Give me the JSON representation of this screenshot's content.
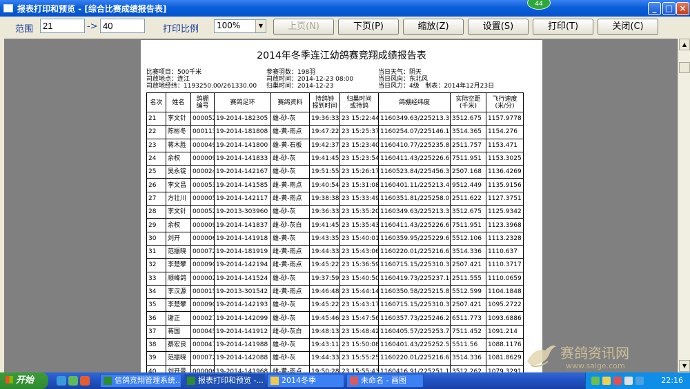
{
  "window": {
    "title": "报表打印和预览 - [综合比赛成绩报告表]",
    "badge": "44"
  },
  "toolbar": {
    "range_label": "范围",
    "range_from": "21",
    "range_arrow": "->",
    "range_to": "40",
    "print_scale_label": "打印比例",
    "print_scale_value": "100%",
    "prev_page": "上页(N)",
    "next_page": "下页(P)",
    "zoom": "缩放(Z)",
    "setup": "设置(S)",
    "print": "打印(T)",
    "close": "关闭(C)"
  },
  "report": {
    "title": "2014年冬季连江幼鸽赛竞翔成绩报告表",
    "info": {
      "project": "比赛项目：500千米",
      "release_place": "司放地点：连江",
      "release_coord": "司放地经纬：1193250.00/261330.00",
      "entries": "参赛羽数：198羽",
      "release_time": "司放时间：2014-12-23 08:00",
      "return_time": "归巢时间：2014-12-23",
      "weather": "当日天气：阴天",
      "wind_dir": "当日风向：东北风",
      "wind_force": "当日风力：4级",
      "made_on": "制表：2014年12月23日"
    },
    "columns": [
      "名次",
      "姓名",
      "鸽棚\n编号",
      "赛鸽足环",
      "赛鸽资料",
      "持鸽钟\n报到时间",
      "归巢时间\n或持鸽",
      "鸽棚经纬度",
      "实际空距\n(千米)",
      "飞行速度\n(米/分)"
    ],
    "rows": [
      [
        "21",
        "李文针",
        "000052",
        "19-2014-182305",
        "雄-砂-灰",
        "19:36:33",
        "23 15:22:44",
        "1160349.63/225213.3",
        "3512.675",
        "1157.9778"
      ],
      [
        "22",
        "陈彬冬",
        "000113",
        "19-2014-181808",
        "雄-黄-雨点",
        "19:47:22",
        "23 15:25:37",
        "1160254.07/225146.1",
        "3514.365",
        "1154.276"
      ],
      [
        "23",
        "蒋木胜",
        "000049",
        "19-2014-141800",
        "雄-黄-石板",
        "19:42:37",
        "23 15:23:40",
        "1160410.77/225235.8",
        "2511.757",
        "1153.471"
      ],
      [
        "24",
        "余权",
        "000009",
        "19-2014-141833",
        "雌-砂-灰",
        "19:41:45",
        "23 15:23:54",
        "1160411.43/225226.6",
        "7511.951",
        "1153.3025"
      ],
      [
        "25",
        "吴永锭",
        "000024",
        "19-2014-142167",
        "雄-砂-灰",
        "19:51:55",
        "23 15:26:17",
        "1160523.84/225456.3",
        "2507.168",
        "1136.4269"
      ],
      [
        "26",
        "李文昌",
        "000053",
        "19-2014-141585",
        "雌-黄-雨点",
        "19:40:54",
        "23 15:31:08",
        "1160401.11/225213.4",
        "9512.449",
        "1135.9156"
      ],
      [
        "27",
        "方壮川",
        "000005",
        "19-2014-142117",
        "雌-黄-雨点",
        "19:38:38",
        "23 15:33:49",
        "1160351.81/225258.0",
        "2511.622",
        "1127.3751"
      ],
      [
        "28",
        "李文针",
        "000052",
        "19-2013-303960",
        "雄-砂-灰",
        "19:36:33",
        "23 15:35:20",
        "1160349.63/225213.3",
        "3512.675",
        "1125.9342"
      ],
      [
        "29",
        "余权",
        "000009",
        "19-2014-141837",
        "雌-砂-灰白",
        "19:41:45",
        "23 15:35:43",
        "1160411.43/225226.6",
        "7511.951",
        "1123.3968"
      ],
      [
        "30",
        "刘开",
        "000006",
        "19-2014-141918",
        "雄-黄-灰",
        "19:43:35",
        "23 15:40:01",
        "1160359.95/225229.6",
        "5512.106",
        "1113.2328"
      ],
      [
        "31",
        "范振晓",
        "000072",
        "19-2014-181919",
        "雌-黄-雨点",
        "19:44:33",
        "23 15:43:06",
        "1160220.01/225216.6",
        "3514.336",
        "1110.637"
      ],
      [
        "32",
        "李楚攀",
        "000090",
        "19-2014-142194",
        "雌-黄-雨点",
        "19:45:22",
        "23 15:36:59",
        "1160715.15/225310.3",
        "2507.421",
        "1110.3717"
      ],
      [
        "33",
        "顺峰鸽",
        "000002",
        "19-2014-141524",
        "雄-砂-灰",
        "19:37:59",
        "23 15:40:50",
        "1160419.73/225237.1",
        "2511.555",
        "1110.0659"
      ],
      [
        "34",
        "李汉源",
        "000015",
        "19-2013-301542",
        "雌-黄-雨点",
        "19:46:48",
        "23 15:44:14",
        "1160350.58/225215.8",
        "5512.599",
        "1104.1848"
      ],
      [
        "35",
        "李楚攀",
        "000090",
        "19-2014-142193",
        "雄-砂-灰",
        "19:45:22",
        "23 15:43:17",
        "1160715.15/225310.3",
        "2507.421",
        "1095.2722"
      ],
      [
        "36",
        "谢正",
        "000027",
        "19-2014-142099",
        "雄-砂-灰",
        "19:45:46",
        "23 15:47:56",
        "1160357.73/225246.2",
        "6511.773",
        "1093.6886"
      ],
      [
        "37",
        "蒋国",
        "000045",
        "19-2014-141912",
        "雌-砂-灰白",
        "19:48:13",
        "23 15:48:42",
        "1160405.57/225253.7",
        "7511.452",
        "1091.214"
      ],
      [
        "38",
        "蔡宏良",
        "000047",
        "19-2014-141988",
        "雄-砂-灰",
        "19:43:11",
        "23 15:50:08",
        "1160401.43/225252.5",
        "5511.56",
        "1088.1176"
      ],
      [
        "39",
        "范振晓",
        "000072",
        "19-2014-142088",
        "雄-砂-灰",
        "19:44:33",
        "23 15:55:25",
        "1160220.01/225216.6",
        "3514.336",
        "1081.8629"
      ],
      [
        "40",
        "刘开景",
        "000006",
        "19-2014-141968",
        "雌-黄-雨点",
        "19:50:28",
        "23 15:55:43",
        "1160416.91/225251.1",
        "3512.262",
        "1079.3291"
      ]
    ]
  },
  "taskbar": {
    "start": "开始",
    "tasks": [
      "信鸽竞翔管理系统...",
      "报表打印和预览 -...",
      "2014冬季",
      "未命名 - 画图"
    ],
    "clock": "22:16"
  },
  "watermark": {
    "text": "赛鸽资讯网",
    "url": "www.saige.com"
  },
  "colors": {
    "titlebar": "#0a5fd8",
    "taskbar": "#2456c7",
    "start": "#3c9a3c",
    "viewer_bg": "#808080"
  }
}
